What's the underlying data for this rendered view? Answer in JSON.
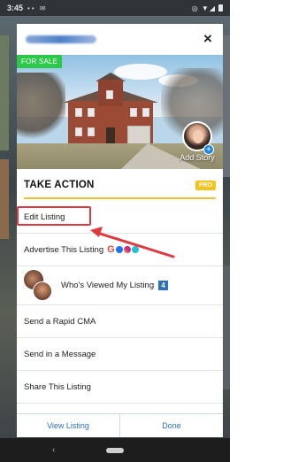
{
  "status_bar": {
    "time": "3:45",
    "left_icons": "•• ✉",
    "right_icons": "◎ ▼◢"
  },
  "header": {
    "close_icon": "×"
  },
  "listing": {
    "badge": "FOR SALE",
    "story_label": "Add Story",
    "plus": "+"
  },
  "section": {
    "title": "TAKE ACTION",
    "pro_badge": "PRO"
  },
  "menu": {
    "items": [
      {
        "label": "Edit Listing"
      },
      {
        "label": "Advertise This Listing",
        "social_icons": [
          "google-icon",
          "facebook-icon",
          "instagram-icon",
          "messenger-icon"
        ],
        "google_glyph": "G"
      },
      {
        "label": "Who's Viewed My Listing",
        "count": "4"
      },
      {
        "label": "Send a Rapid CMA"
      },
      {
        "label": "Send in a Message"
      },
      {
        "label": "Share This Listing"
      }
    ]
  },
  "footer": {
    "left_button": "View Listing",
    "right_button": "Done"
  },
  "nav_bar": {
    "back_icon": "‹"
  },
  "colors": {
    "for_sale": "#2cc84a",
    "pro_badge": "#f6c21a",
    "accent_link": "#2a6fbd",
    "annotation": "#e0383e"
  }
}
